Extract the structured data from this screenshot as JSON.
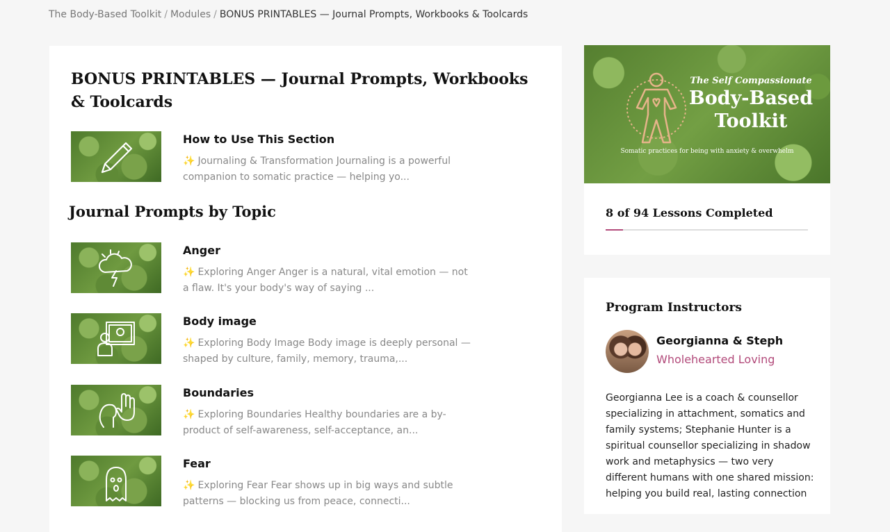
{
  "breadcrumb": {
    "items": [
      "The Body-Based Toolkit",
      "Modules"
    ],
    "current": "BONUS PRINTABLES — Journal Prompts, Workbooks & Toolcards",
    "separator": "/"
  },
  "page_title": "BONUS PRINTABLES — Journal Prompts, Workbooks & Toolcards",
  "intro_lesson": {
    "title": "How to Use This Section",
    "excerpt": "Journaling & Transformation Journaling is a powerful companion to somatic practice — helping yo...",
    "icon": "pencil-icon"
  },
  "section_heading": "Journal Prompts by Topic",
  "lessons": [
    {
      "title": "Anger",
      "excerpt": "Exploring Anger Anger is a natural, vital emotion — not a flaw. It's your body's way of saying ...",
      "icon": "storm-cloud-icon"
    },
    {
      "title": "Body image",
      "excerpt": "Exploring Body Image Body image is deeply personal — shaped by culture, family, memory, trauma,...",
      "icon": "mirror-person-icon"
    },
    {
      "title": "Boundaries",
      "excerpt": "Exploring Boundaries Healthy boundaries are a by-product of self-awareness, self-acceptance, an...",
      "icon": "raised-hand-icon"
    },
    {
      "title": "Fear",
      "excerpt": "Exploring Fear Fear shows up in big ways and subtle patterns — blocking us from peace, connecti...",
      "icon": "ghost-icon"
    }
  ],
  "excerpt_marker": "✨",
  "banner": {
    "subtitle": "The Self Compassionate",
    "title_line1": "Body-Based",
    "title_line2": "Toolkit",
    "tagline": "Somatic practices for being with anxiety & overwhelm"
  },
  "progress": {
    "text": "8 of 94 Lessons Completed",
    "completed": 8,
    "total": 94,
    "fraction": 0.0851
  },
  "instructors": {
    "heading": "Program Instructors",
    "name": "Georgianna & Steph",
    "org": "Wholehearted Loving",
    "bio": "Georgianna Lee is a coach & counsellor specializing in attachment, somatics and family systems; Stephanie Hunter is a spiritual counsellor specializing in shadow work and metaphysics — two very different humans with one shared mission: helping you build real, lasting connection"
  },
  "colors": {
    "accent": "#b24a7a",
    "banner_figure": "#e6b48a"
  }
}
